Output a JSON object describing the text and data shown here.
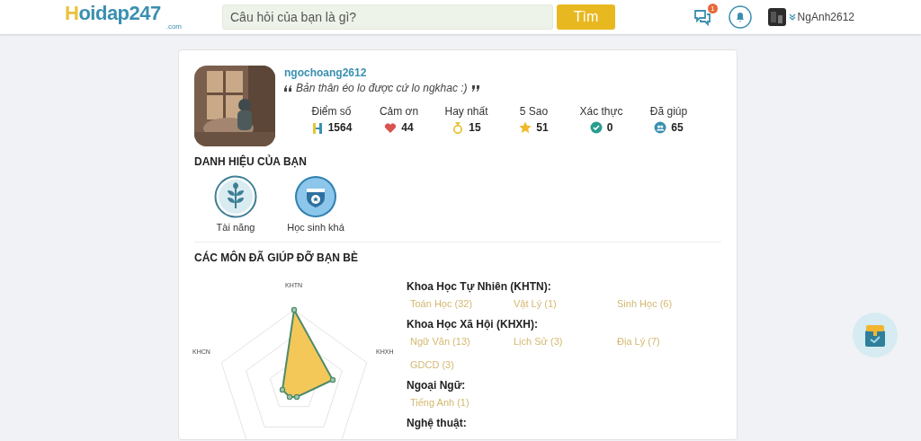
{
  "header": {
    "logo": "Hoidap247",
    "logo_suffix": ".com",
    "search": {
      "placeholder": "Câu hỏi của bạn là gì?"
    },
    "search_button": "Tìm",
    "message_count": "1",
    "username": "NgAnh2612"
  },
  "profile": {
    "username": "ngochoang2612",
    "bio": "Bản thân éo lo được cứ lo ngkhac :)",
    "stats": [
      {
        "kind": "points",
        "label": "Điểm số",
        "value": "1564"
      },
      {
        "kind": "thanks",
        "label": "Cảm ơn",
        "value": "44"
      },
      {
        "kind": "best",
        "label": "Hay nhất",
        "value": "15"
      },
      {
        "kind": "stars",
        "label": "5 Sao",
        "value": "51"
      },
      {
        "kind": "verified",
        "label": "Xác thực",
        "value": "0"
      },
      {
        "kind": "helped",
        "label": "Đã giúp",
        "value": "65"
      }
    ]
  },
  "titles": {
    "heading": "DANH HIỆU CỦA BẠN",
    "items": [
      {
        "kind": "talent",
        "label": "Tài năng"
      },
      {
        "kind": "student",
        "label": "Học sinh khá"
      }
    ]
  },
  "subjects": {
    "heading": "CÁC MÔN ĐÃ GIÚP ĐỠ BẠN BÈ",
    "radar_axes": [
      "KHTN",
      "KHXH",
      "KHCN"
    ],
    "groups": [
      {
        "title": "Khoa Học Tự Nhiên (KHTN):",
        "items": [
          "Toán Học (32)",
          "Vật Lý (1)",
          "Sinh Học (6)"
        ]
      },
      {
        "title": "Khoa Học Xã Hội (KHXH):",
        "items": [
          "Ngữ Văn (13)",
          "Lịch Sử (3)",
          "Địa Lý (7)",
          "GDCD (3)"
        ]
      },
      {
        "title": "Ngoại Ngữ:",
        "items": [
          "Tiếng Anh (1)"
        ]
      },
      {
        "title": "Nghệ thuật:"
      }
    ]
  }
}
